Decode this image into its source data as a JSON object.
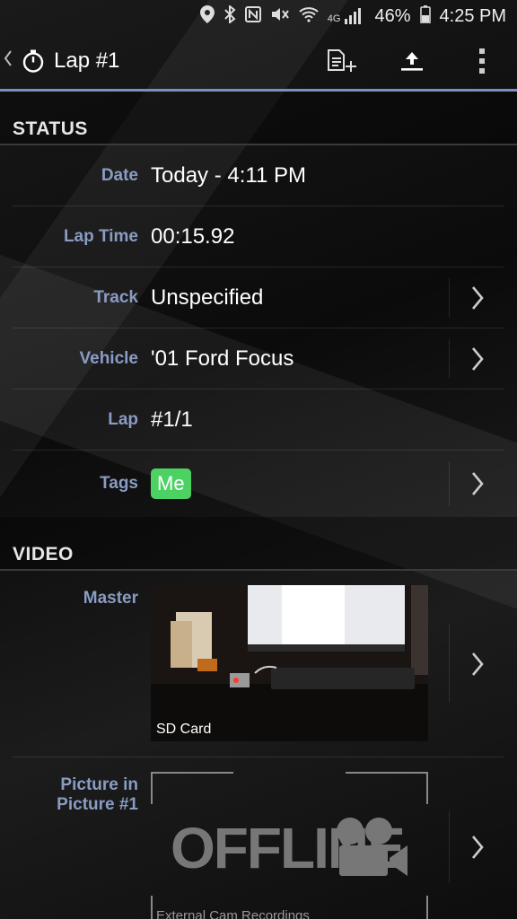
{
  "status_bar": {
    "battery": "46%",
    "time": "4:25 PM",
    "network": "4G"
  },
  "action_bar": {
    "title": "Lap #1",
    "icons": [
      "back-chevron-icon",
      "stopwatch-icon",
      "add-note-icon",
      "upload-icon",
      "overflow-menu-icon"
    ]
  },
  "status_section": {
    "header": "STATUS",
    "rows": [
      {
        "label": "Date",
        "value": "Today - 4:11 PM"
      },
      {
        "label": "Lap Time",
        "value": "00:15.92"
      },
      {
        "label": "Track",
        "value": "Unspecified"
      },
      {
        "label": "Vehicle",
        "value": "'01 Ford Focus"
      },
      {
        "label": "Lap",
        "value": "#1/1"
      },
      {
        "label": "Tags",
        "value": "Me"
      }
    ]
  },
  "video_section": {
    "header": "VIDEO",
    "master": {
      "label": "Master",
      "caption": "SD Card"
    },
    "pip": {
      "label": "Picture in Picture #1",
      "offline_text": "OFFLINE",
      "caption": "External Cam Recordings"
    }
  },
  "colors": {
    "label": "#8a9cc4",
    "accent_line": "#7c8fbf",
    "tag": "#4cd263"
  }
}
